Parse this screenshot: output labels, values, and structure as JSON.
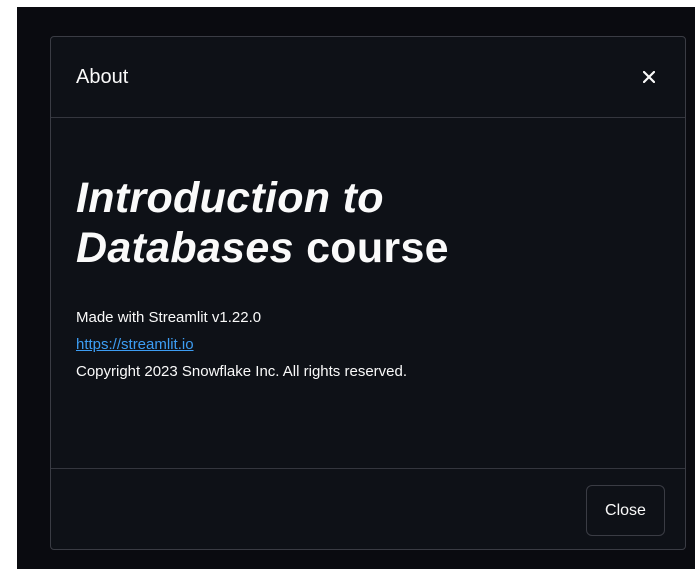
{
  "dialog": {
    "title": "About",
    "close_icon": "close-icon",
    "heading_part1": "Introduction to",
    "heading_part2_italic": "Databases",
    "heading_part2_rest": " course",
    "made_with": "Made with Streamlit v1.22.0",
    "link_text": "https://streamlit.io",
    "copyright": "Copyright 2023 Snowflake Inc. All rights reserved.",
    "close_button_label": "Close"
  },
  "colors": {
    "backdrop": "#0a0b10",
    "modal_bg": "#0e1117",
    "border": "#3a3c44",
    "text": "#fafafa",
    "link": "#3d9df3"
  }
}
